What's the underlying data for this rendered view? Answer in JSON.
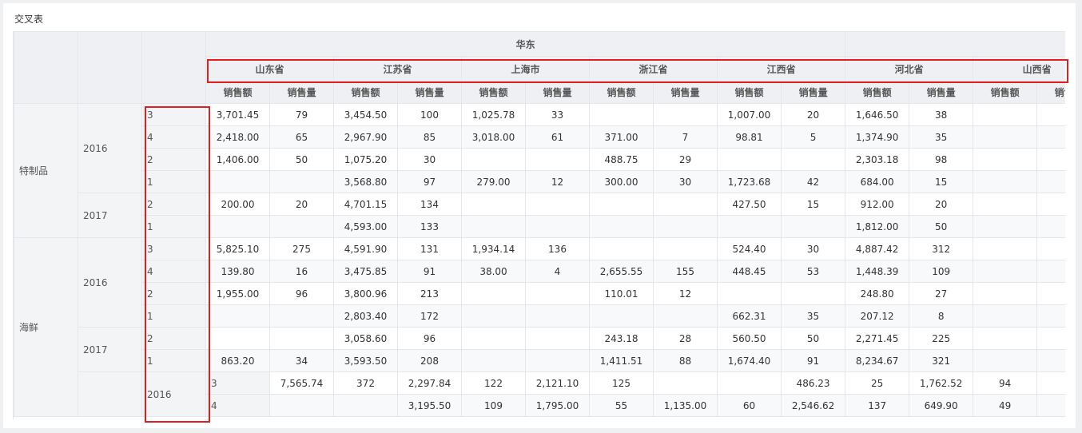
{
  "panel": {
    "title": "交叉表"
  },
  "header": {
    "region": "华东",
    "provinces": [
      "山东省",
      "江苏省",
      "上海市",
      "浙江省",
      "江西省",
      "河北省",
      "山西省"
    ],
    "measures": [
      "销售额",
      "销售量"
    ]
  },
  "rows": [
    {
      "category": "特制品",
      "year": "2016",
      "month": "3",
      "cells": [
        "3,701.45",
        "79",
        "3,454.50",
        "100",
        "1,025.78",
        "33",
        "",
        "",
        "1,007.00",
        "20",
        "1,646.50",
        "38",
        "",
        ""
      ]
    },
    {
      "category": "",
      "year": "",
      "month": "4",
      "cells": [
        "2,418.00",
        "65",
        "2,967.90",
        "85",
        "3,018.00",
        "61",
        "371.00",
        "7",
        "98.81",
        "5",
        "1,374.90",
        "35",
        "",
        ""
      ]
    },
    {
      "category": "",
      "year": "",
      "month": "2",
      "cells": [
        "1,406.00",
        "50",
        "1,075.20",
        "30",
        "",
        "",
        "488.75",
        "29",
        "",
        "",
        "2,303.18",
        "98",
        "",
        ""
      ]
    },
    {
      "category": "",
      "year": "",
      "month": "1",
      "cells": [
        "",
        "",
        "3,568.80",
        "97",
        "279.00",
        "12",
        "300.00",
        "30",
        "1,723.68",
        "42",
        "684.00",
        "15",
        "",
        ""
      ]
    },
    {
      "category": "",
      "year": "2017",
      "month": "2",
      "cells": [
        "200.00",
        "20",
        "4,701.15",
        "134",
        "",
        "",
        "",
        "",
        "427.50",
        "15",
        "912.00",
        "20",
        "",
        ""
      ]
    },
    {
      "category": "",
      "year": "",
      "month": "1",
      "cells": [
        "",
        "",
        "4,593.00",
        "133",
        "",
        "",
        "",
        "",
        "",
        "",
        "1,812.00",
        "50",
        "",
        ""
      ]
    },
    {
      "category": "海鲜",
      "year": "2016",
      "month": "3",
      "cells": [
        "5,825.10",
        "275",
        "4,591.90",
        "131",
        "1,934.14",
        "136",
        "",
        "",
        "524.40",
        "30",
        "4,887.42",
        "312",
        "",
        ""
      ]
    },
    {
      "category": "",
      "year": "",
      "month": "4",
      "cells": [
        "139.80",
        "16",
        "3,475.85",
        "91",
        "38.00",
        "4",
        "2,655.55",
        "155",
        "448.45",
        "53",
        "1,448.39",
        "109",
        "",
        ""
      ]
    },
    {
      "category": "",
      "year": "",
      "month": "2",
      "cells": [
        "1,955.00",
        "96",
        "3,800.96",
        "213",
        "",
        "",
        "110.01",
        "12",
        "",
        "",
        "248.80",
        "27",
        "",
        ""
      ]
    },
    {
      "category": "",
      "year": "",
      "month": "1",
      "cells": [
        "",
        "",
        "2,803.40",
        "172",
        "",
        "",
        "",
        "",
        "662.31",
        "35",
        "207.12",
        "8",
        "",
        ""
      ]
    },
    {
      "category": "",
      "year": "2017",
      "month": "2",
      "cells": [
        "",
        "",
        "3,058.60",
        "96",
        "",
        "",
        "243.18",
        "28",
        "560.50",
        "50",
        "2,271.45",
        "225",
        "",
        ""
      ]
    },
    {
      "category": "",
      "year": "",
      "month": "1",
      "cells": [
        "863.20",
        "34",
        "3,593.50",
        "208",
        "",
        "",
        "1,411.51",
        "88",
        "1,674.40",
        "91",
        "8,234.67",
        "321",
        "",
        ""
      ]
    },
    {
      "category": "",
      "year": "2016",
      "month": "3",
      "cells": [
        "7,565.74",
        "372",
        "2,297.84",
        "122",
        "2,121.10",
        "125",
        "",
        "",
        "486.23",
        "25",
        "1,762.52",
        "94",
        "",
        ""
      ]
    },
    {
      "category": "",
      "year": "",
      "month": "4",
      "cells": [
        "",
        "",
        "3,195.50",
        "109",
        "1,795.00",
        "55",
        "1,135.00",
        "60",
        "2,546.62",
        "137",
        "649.90",
        "49",
        "",
        ""
      ]
    }
  ],
  "colors": {
    "highlight": "#e02020",
    "header_bg": "#eef0f3",
    "border": "#e3e6ea"
  }
}
